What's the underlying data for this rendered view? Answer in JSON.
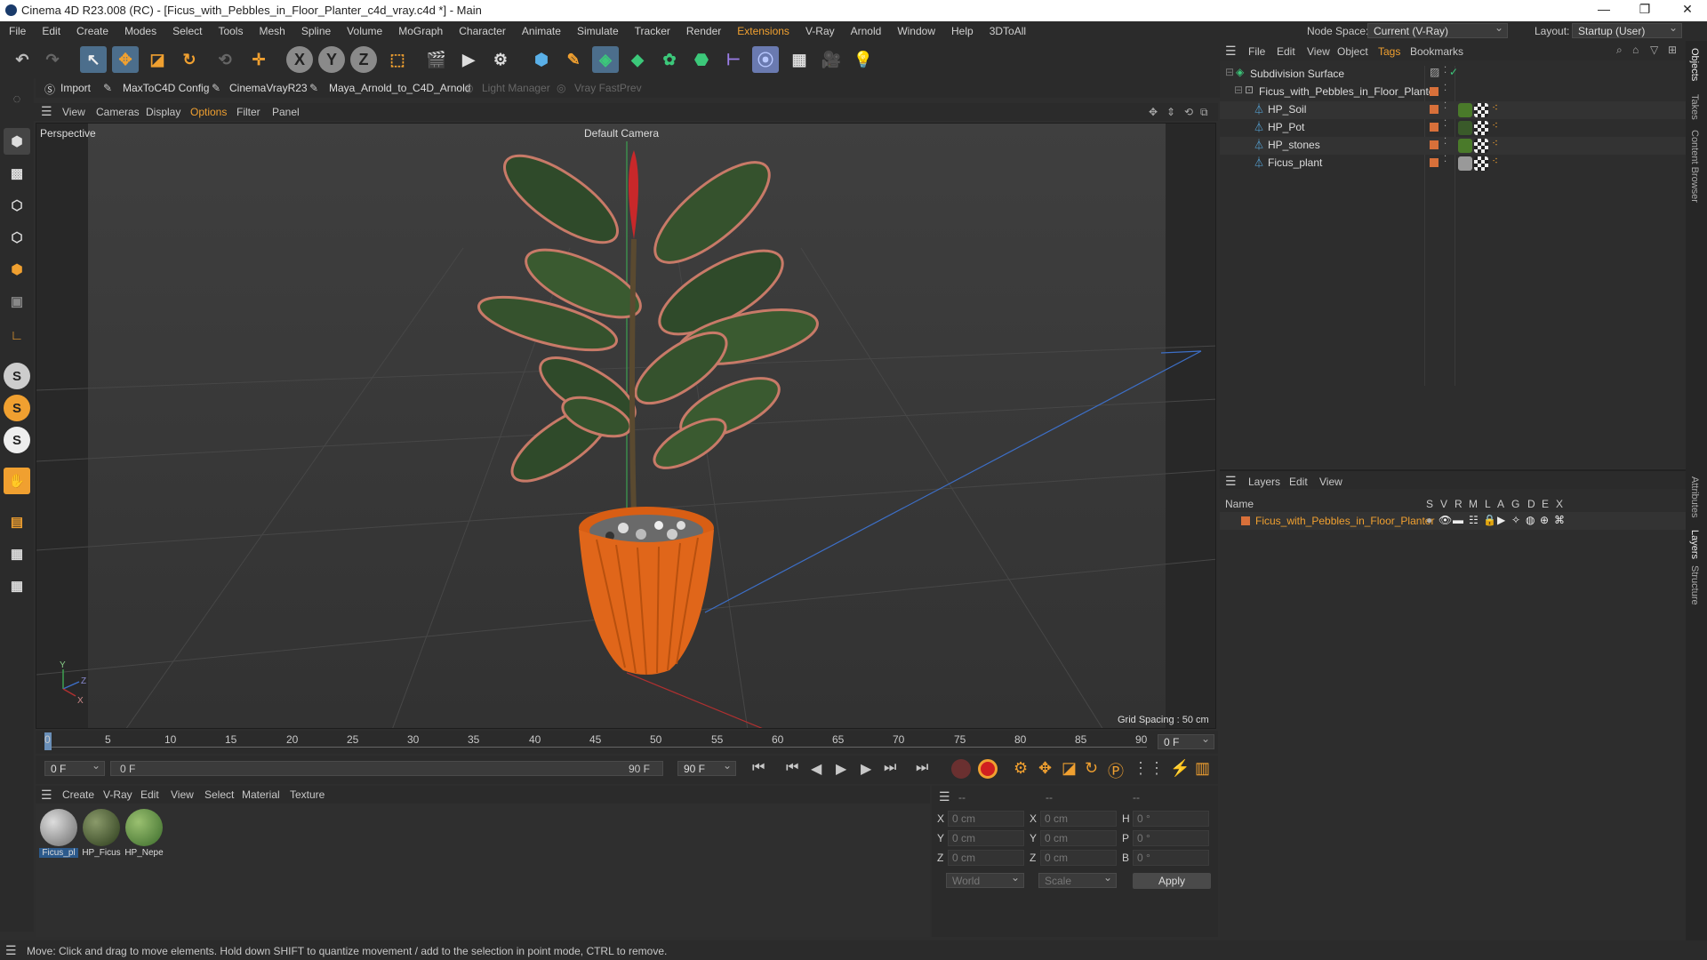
{
  "window": {
    "title": "Cinema 4D R23.008 (RC) - [Ficus_with_Pebbles_in_Floor_Planter_c4d_vray.c4d *] - Main",
    "controls": [
      "—",
      "❐",
      "✕"
    ]
  },
  "menu": {
    "items": [
      "File",
      "Edit",
      "Create",
      "Modes",
      "Select",
      "Tools",
      "Mesh",
      "Spline",
      "Volume",
      "MoGraph",
      "Character",
      "Animate",
      "Simulate",
      "Tracker",
      "Render",
      "Extensions",
      "V-Ray",
      "Arnold",
      "Window",
      "Help",
      "3DToAll"
    ]
  },
  "node_space": {
    "label": "Node Space:",
    "value": "Current (V-Ray)",
    "layout_label": "Layout:",
    "layout_value": "Startup (User)"
  },
  "plugins": {
    "items": [
      "Import",
      "MaxToC4D Config",
      "CinemaVrayR23",
      "Maya_Arnold_to_C4D_Arnold",
      "Light Manager",
      "Vray FastPrev"
    ]
  },
  "viewport_menu": {
    "items": [
      "View",
      "Cameras",
      "Display",
      "Options",
      "Filter",
      "Panel"
    ]
  },
  "viewport": {
    "label": "Perspective",
    "camera": "Default Camera",
    "grid_spacing": "Grid Spacing : 50 cm"
  },
  "timeline": {
    "ticks": [
      "0",
      "5",
      "10",
      "15",
      "20",
      "25",
      "30",
      "35",
      "40",
      "45",
      "50",
      "55",
      "60",
      "65",
      "70",
      "75",
      "80",
      "85",
      "90"
    ],
    "current_frame": "0 F"
  },
  "transport": {
    "start": "0 F",
    "current": "0 F",
    "end_in": "90 F",
    "end": "90 F"
  },
  "material_menu": {
    "items": [
      "Create",
      "V-Ray",
      "Edit",
      "View",
      "Select",
      "Material",
      "Texture"
    ]
  },
  "materials": [
    {
      "name": "Ficus_pl"
    },
    {
      "name": "HP_Ficus"
    },
    {
      "name": "HP_Nepe"
    }
  ],
  "coords": {
    "header": [
      "--",
      "--",
      "--"
    ],
    "rows": [
      {
        "a": "X",
        "v1": "0 cm",
        "b": "X",
        "v2": "0 cm",
        "c": "H",
        "v3": "0 °"
      },
      {
        "a": "Y",
        "v1": "0 cm",
        "b": "Y",
        "v2": "0 cm",
        "c": "P",
        "v3": "0 °"
      },
      {
        "a": "Z",
        "v1": "0 cm",
        "b": "Z",
        "v2": "0 cm",
        "c": "B",
        "v3": "0 °"
      }
    ],
    "world": "World",
    "scale": "Scale",
    "apply": "Apply"
  },
  "object_menu": {
    "items": [
      "File",
      "Edit",
      "View",
      "Object",
      "Tags",
      "Bookmarks"
    ]
  },
  "objects": [
    {
      "name": "Subdivision Surface"
    },
    {
      "name": "Ficus_with_Pebbles_in_Floor_Planter"
    },
    {
      "name": "HP_Soil"
    },
    {
      "name": "HP_Pot"
    },
    {
      "name": "HP_stones"
    },
    {
      "name": "Ficus_plant"
    }
  ],
  "layers_menu": {
    "items": [
      "Layers",
      "Edit",
      "View"
    ]
  },
  "layers_header": {
    "name": "Name",
    "cols": [
      "S",
      "V",
      "R",
      "M",
      "L",
      "A",
      "G",
      "D",
      "E",
      "X"
    ]
  },
  "layers": [
    {
      "name": "Ficus_with_Pebbles_in_Floor_Planter"
    }
  ],
  "side_tabs": [
    "Objects",
    "Takes",
    "Content Browser",
    "Attributes",
    "Layers",
    "Structure"
  ],
  "status": "Move: Click and drag to move elements. Hold down SHIFT to quantize movement / add to the selection in point mode, CTRL to remove.",
  "colors": {
    "accent": "#f0a030",
    "pot": "#e0661a",
    "layer": "#d8703a"
  }
}
